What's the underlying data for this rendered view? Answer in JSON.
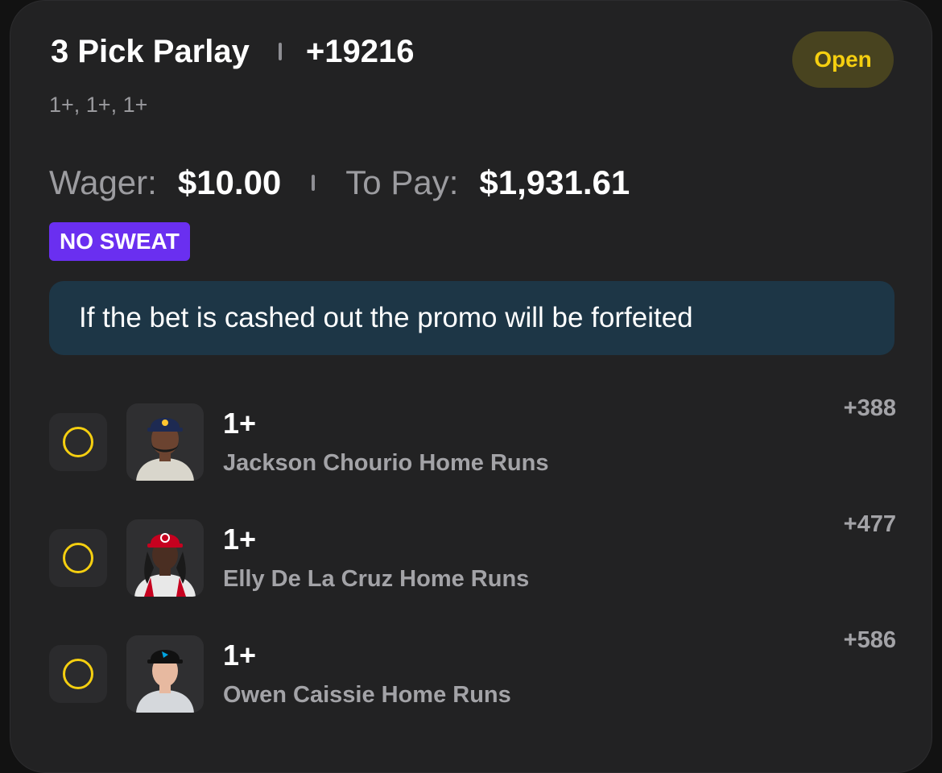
{
  "bet": {
    "title": "3 Pick Parlay",
    "total_odds": "+19216",
    "status": "Open",
    "selections_summary": "1+, 1+, 1+",
    "wager_label": "Wager:",
    "wager_value": "$10.00",
    "to_pay_label": "To Pay:",
    "to_pay_value": "$1,931.61",
    "promo_badge": "NO SWEAT",
    "notice": "If the bet is cashed out the promo will be forfeited"
  },
  "picks": [
    {
      "line": "1+",
      "market": "Jackson Chourio Home Runs",
      "odds": "+388",
      "cap_color": "#1d2a52",
      "cap_logo_color": "#ffc52f",
      "jersey_color": "#d9d6cc",
      "skin_color": "#6b4330"
    },
    {
      "line": "1+",
      "market": "Elly De La Cruz Home Runs",
      "odds": "+477",
      "cap_color": "#c6011f",
      "cap_logo_color": "#ffffff",
      "jersey_color": "#e8e8e8",
      "skin_color": "#4a2e22"
    },
    {
      "line": "1+",
      "market": "Owen Caissie Home Runs",
      "odds": "+586",
      "cap_color": "#111111",
      "cap_logo_color": "#00a3e0",
      "jersey_color": "#d5d8dc",
      "skin_color": "#e7b9a0"
    }
  ],
  "colors": {
    "accent_yellow": "#f5cf10",
    "promo_purple": "#6a2ff0",
    "notice_bg": "#1d3646",
    "card_bg": "#222223"
  }
}
